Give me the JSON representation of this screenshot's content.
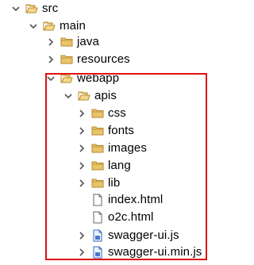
{
  "tree": {
    "nodes": [
      {
        "label": "src",
        "chevron": "down",
        "icon": "folder-open"
      },
      {
        "label": "main",
        "chevron": "down",
        "icon": "folder-open"
      },
      {
        "label": "java",
        "chevron": "right",
        "icon": "folder"
      },
      {
        "label": "resources",
        "chevron": "right",
        "icon": "folder"
      },
      {
        "label": "webapp",
        "chevron": "down",
        "icon": "folder-open"
      },
      {
        "label": "apis",
        "chevron": "down",
        "icon": "folder-open"
      },
      {
        "label": "css",
        "chevron": "right",
        "icon": "folder"
      },
      {
        "label": "fonts",
        "chevron": "right",
        "icon": "folder"
      },
      {
        "label": "images",
        "chevron": "right",
        "icon": "folder"
      },
      {
        "label": "lang",
        "chevron": "right",
        "icon": "folder"
      },
      {
        "label": "lib",
        "chevron": "right",
        "icon": "folder"
      },
      {
        "label": "index.html",
        "chevron": "none",
        "icon": "file"
      },
      {
        "label": "o2c.html",
        "chevron": "none",
        "icon": "file"
      },
      {
        "label": "swagger-ui.js",
        "chevron": "right",
        "icon": "js-file"
      },
      {
        "label": "swagger-ui.min.js",
        "chevron": "right",
        "icon": "js-file"
      }
    ]
  },
  "colors": {
    "highlight_border": "#e01010",
    "folder_fill": "#e8c56a",
    "folder_stroke": "#b8892e",
    "chevron": "#555555"
  }
}
